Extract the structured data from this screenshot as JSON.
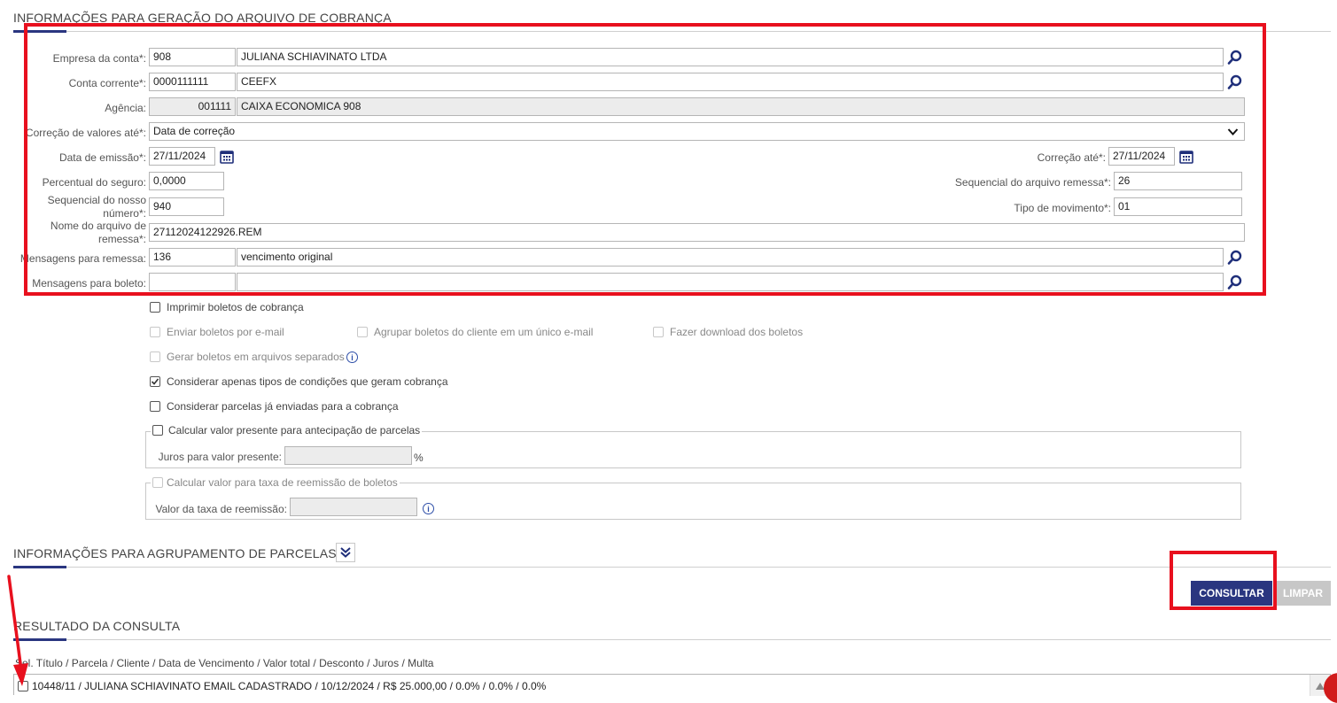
{
  "colors": {
    "accent": "#2a3680",
    "highlight": "#e8101e",
    "search_icon": "#1f2f7a"
  },
  "section_geracao": {
    "title": "INFORMAÇÕES PARA GERAÇÃO DO ARQUIVO DE COBRANÇA"
  },
  "form": {
    "empresa": {
      "label": "Empresa da conta*:",
      "code": "908",
      "name": "JULIANA SCHIAVINATO LTDA"
    },
    "conta": {
      "label": "Conta corrente*:",
      "code": "0000111111",
      "name": "CEEFX"
    },
    "agencia": {
      "label": "Agência:",
      "code": "001111",
      "name": "CAIXA ECONOMICA 908"
    },
    "correcao_valores": {
      "label": "Correção de valores até*:",
      "selected": "Data de correção"
    },
    "data_emissao": {
      "label": "Data de emissão*:",
      "value": "27/11/2024"
    },
    "correcao_ate": {
      "label": "Correção até*:",
      "value": "27/11/2024"
    },
    "percentual_seguro": {
      "label": "Percentual do seguro:",
      "value": "0,0000"
    },
    "sequencial_remessa": {
      "label": "Sequencial do arquivo remessa*:",
      "value": "26"
    },
    "sequencial_nosso_numero": {
      "label_line1": "Sequencial do nosso",
      "label_line2": "número*:",
      "value": "940"
    },
    "tipo_movimento": {
      "label": "Tipo de movimento*:",
      "value": "01"
    },
    "nome_arquivo": {
      "label_line1": "Nome do arquivo de",
      "label_line2": "remessa*:",
      "value": "27112024122926.REM"
    },
    "mensagens_remessa": {
      "label": "Mensagens para remessa:",
      "code": "136",
      "text": "vencimento original"
    },
    "mensagens_boleto": {
      "label": "Mensagens para boleto:",
      "code": "",
      "text": ""
    }
  },
  "options": {
    "imprimir": {
      "label": "Imprimir boletos de cobrança"
    },
    "enviar_email": {
      "label": "Enviar boletos por e-mail"
    },
    "agrupar_email": {
      "label": "Agrupar boletos do cliente em um único e-mail"
    },
    "download": {
      "label": "Fazer download dos boletos"
    },
    "separados": {
      "label": "Gerar boletos em arquivos separados"
    },
    "considerar_tipos": {
      "label": "Considerar apenas tipos de condições que geram cobrança"
    },
    "considerar_enviadas": {
      "label": "Considerar parcelas já enviadas para a cobrança"
    },
    "valor_presente": {
      "label": "Calcular valor presente para antecipação de parcelas",
      "juros_label": "Juros para valor presente:",
      "juros_unit": "%"
    },
    "reemissao": {
      "label": "Calcular valor para taxa de reemissão de boletos",
      "taxa_label": "Valor da taxa de reemissão:"
    }
  },
  "section_agrupamento": {
    "title": "INFORMAÇÕES PARA AGRUPAMENTO DE PARCELAS"
  },
  "buttons": {
    "consultar": "CONSULTAR",
    "limpar": "LIMPAR"
  },
  "section_resultado": {
    "title": "RESULTADO DA CONSULTA",
    "header": "Sel. Título / Parcela / Cliente / Data de Vencimento / Valor total / Desconto / Juros / Multa",
    "rows": [
      {
        "text": "10448/11 / JULIANA SCHIAVINATO EMAIL CADASTRADO / 10/12/2024 / R$ 25.000,00 / 0.0% / 0.0% / 0.0%"
      }
    ]
  }
}
